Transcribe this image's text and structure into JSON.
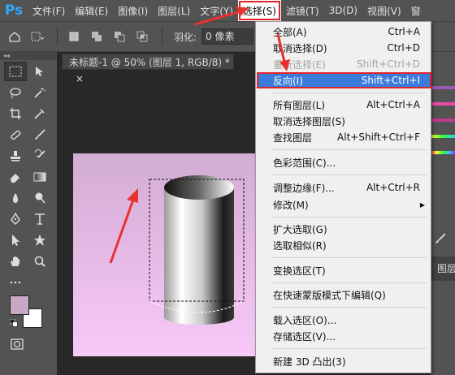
{
  "app": {
    "logo": "Ps"
  },
  "menubar": {
    "items": [
      {
        "label": "文件(F)"
      },
      {
        "label": "编辑(E)"
      },
      {
        "label": "图像(I)"
      },
      {
        "label": "图层(L)"
      },
      {
        "label": "文字(Y)"
      },
      {
        "label": "选择(S)"
      },
      {
        "label": "滤镜(T)"
      },
      {
        "label": "3D(D)"
      },
      {
        "label": "视图(V)"
      },
      {
        "label": "窗"
      }
    ]
  },
  "options": {
    "feather_label": "羽化:",
    "feather_value": "0 像素"
  },
  "tools_header": "◂◂",
  "document": {
    "tab_title": "未标题-1 @ 50% (图层 1, RGB/8) *",
    "close": "×"
  },
  "right_panel": {
    "layers_label": "图层"
  },
  "colors": {
    "foreground": "#c8a8c6",
    "background": "#ffffff",
    "accent": "#e0242a",
    "selection": "#3b7bdb"
  },
  "select_menu": {
    "items": [
      {
        "label": "全部(A)",
        "shortcut": "Ctrl+A",
        "state": "normal"
      },
      {
        "label": "取消选择(D)",
        "shortcut": "Ctrl+D",
        "state": "normal"
      },
      {
        "label": "重新选择(E)",
        "shortcut": "Shift+Ctrl+D",
        "state": "disabled"
      },
      {
        "label": "反向(I)",
        "shortcut": "Shift+Ctrl+I",
        "state": "selected"
      },
      {
        "label": "所有图层(L)",
        "shortcut": "Alt+Ctrl+A",
        "state": "normal"
      },
      {
        "label": "取消选择图层(S)",
        "shortcut": "",
        "state": "normal"
      },
      {
        "label": "查找图层",
        "shortcut": "Alt+Shift+Ctrl+F",
        "state": "normal"
      },
      {
        "label": "色彩范围(C)...",
        "shortcut": "",
        "state": "normal"
      },
      {
        "label": "调整边缘(F)...",
        "shortcut": "Alt+Ctrl+R",
        "state": "normal"
      },
      {
        "label": "修改(M)",
        "shortcut": "",
        "state": "submenu"
      },
      {
        "label": "扩大选取(G)",
        "shortcut": "",
        "state": "normal"
      },
      {
        "label": "选取相似(R)",
        "shortcut": "",
        "state": "normal"
      },
      {
        "label": "变换选区(T)",
        "shortcut": "",
        "state": "normal"
      },
      {
        "label": "在快速蒙版模式下编辑(Q)",
        "shortcut": "",
        "state": "normal"
      },
      {
        "label": "载入选区(O)...",
        "shortcut": "",
        "state": "normal"
      },
      {
        "label": "存储选区(V)...",
        "shortcut": "",
        "state": "normal"
      },
      {
        "label": "新建 3D 凸出(3)",
        "shortcut": "",
        "state": "normal"
      }
    ]
  }
}
